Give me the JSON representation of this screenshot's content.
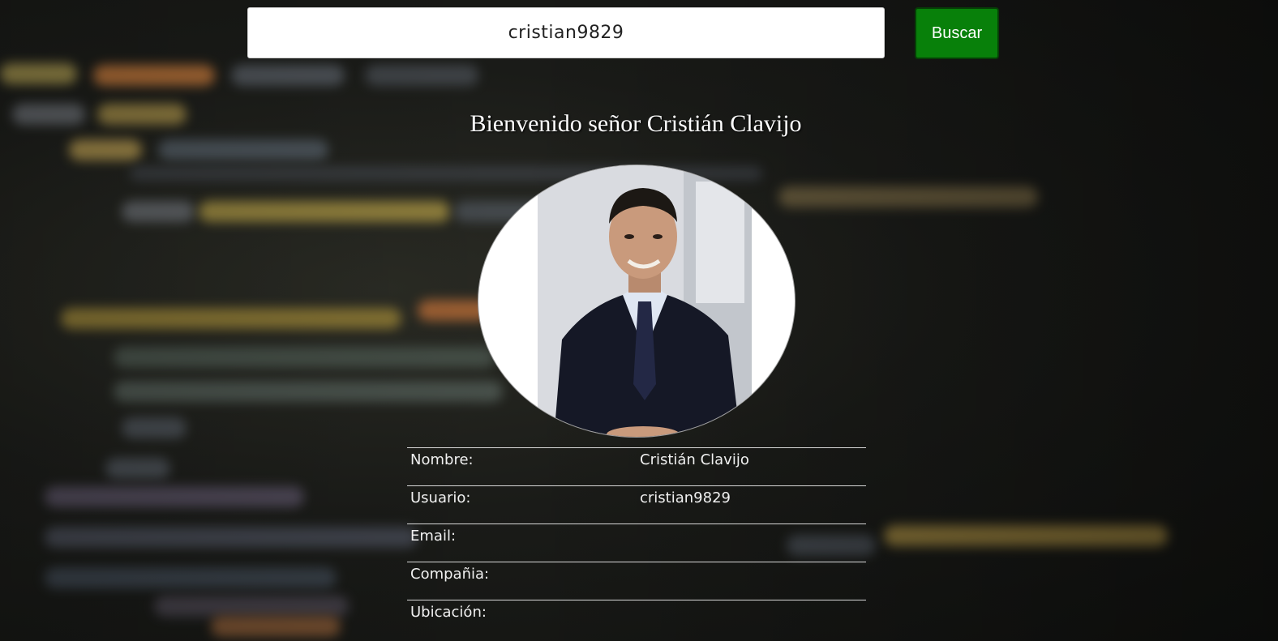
{
  "search": {
    "value": "cristian9829",
    "button_label": "Buscar"
  },
  "welcome": "Bienvenido señor Cristián Clavijo",
  "profile": {
    "rows": [
      {
        "label": "Nombre:",
        "value": "Cristián Clavijo"
      },
      {
        "label": "Usuario:",
        "value": "cristian9829"
      },
      {
        "label": "Email:",
        "value": ""
      },
      {
        "label": "Compañia:",
        "value": ""
      },
      {
        "label": "Ubicación:",
        "value": ""
      }
    ]
  },
  "colors": {
    "button_bg": "#08800a",
    "text": "#ffffff"
  }
}
